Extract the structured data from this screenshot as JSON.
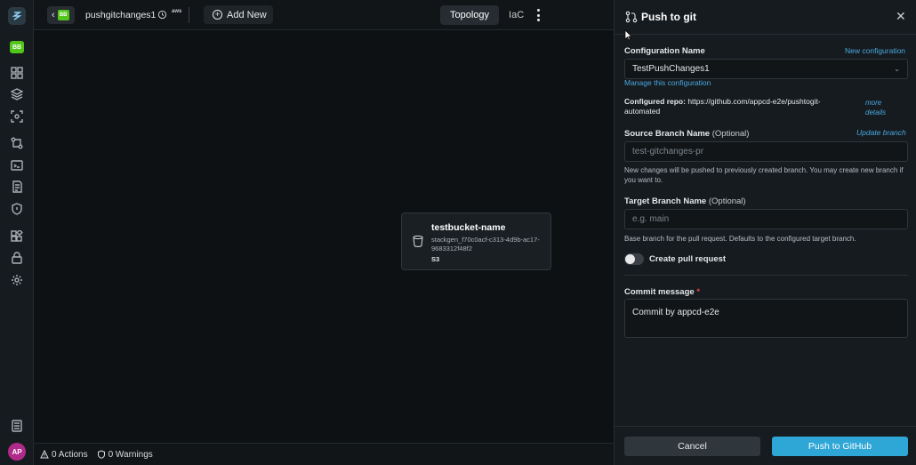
{
  "sidebar": {
    "org_badge": "BB",
    "avatar": "AP",
    "icons": [
      "dashboard-icon",
      "layers-icon",
      "scan-icon",
      "git-branch-icon",
      "terminal-icon",
      "catalog-icon",
      "shield-icon",
      "apps-icon",
      "lock-icon",
      "settings-icon",
      "docs-icon"
    ]
  },
  "topbar": {
    "back_badge": "BB",
    "project_name": "pushgitchanges1",
    "cloud": "aws",
    "add_new": "Add New",
    "tabs": [
      {
        "label": "Topology",
        "active": true
      },
      {
        "label": "IaC",
        "active": false
      }
    ]
  },
  "canvas": {
    "node": {
      "title": "testbucket-name",
      "id": "stackgen_f70c0acf-c313-4d9b-ac17-9683312f48f2",
      "type": "S3"
    }
  },
  "statusbar": {
    "actions": "0 Actions",
    "warnings": "0 Warnings"
  },
  "panel": {
    "title": "Push to git",
    "config_label": "Configuration Name",
    "new_config": "New configuration",
    "config_value": "TestPushChanges1",
    "manage": "Manage this configuration",
    "repo_label": "Configured repo:",
    "repo_url": "https://github.com/appcd-e2e/pushtogit-automated",
    "more_details": "more details",
    "source_label": "Source Branch Name",
    "source_optional": "(Optional)",
    "update_branch": "Update branch",
    "source_placeholder": "test-gitchanges-pr",
    "source_help": "New changes will be pushed to previously created branch. You may create new branch if you want to.",
    "target_label": "Target Branch Name",
    "target_optional": "(Optional)",
    "target_placeholder": "e.g. main",
    "target_help": "Base branch for the pull request. Defaults to the configured target branch.",
    "create_pr": "Create pull request",
    "create_pr_enabled": false,
    "commit_label": "Commit message",
    "commit_required": "*",
    "commit_value": "Commit by appcd-e2e",
    "cancel": "Cancel",
    "push": "Push to GitHub"
  },
  "colors": {
    "accent": "#2ea6d6",
    "link": "#4aa8e0",
    "badge_green": "#52c41a",
    "avatar": "#b02a8a"
  }
}
